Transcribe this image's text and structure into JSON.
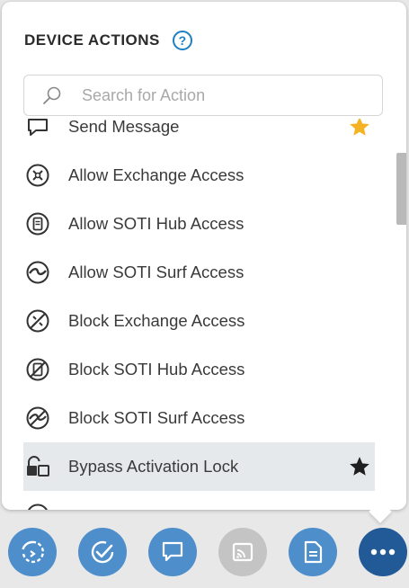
{
  "panel": {
    "title": "DEVICE ACTIONS",
    "help_glyph": "?"
  },
  "search": {
    "placeholder": "Search for Action",
    "value": ""
  },
  "actions": [
    {
      "label": "Send Message",
      "icon": "chat-bubble-icon",
      "favorite": true
    },
    {
      "label": "Allow Exchange Access",
      "icon": "exchange-icon",
      "favorite": false
    },
    {
      "label": "Allow SOTI Hub Access",
      "icon": "hub-icon",
      "favorite": false
    },
    {
      "label": "Allow SOTI Surf Access",
      "icon": "surf-icon",
      "favorite": false
    },
    {
      "label": "Block Exchange Access",
      "icon": "exchange-blocked-icon",
      "favorite": false
    },
    {
      "label": "Block SOTI Hub Access",
      "icon": "hub-blocked-icon",
      "favorite": false
    },
    {
      "label": "Block SOTI Surf Access",
      "icon": "surf-blocked-icon",
      "favorite": false
    },
    {
      "label": "Bypass Activation Lock",
      "icon": "unlock-icon",
      "favorite": true,
      "highlighted": true
    },
    {
      "label": "",
      "icon": "partial-icon",
      "favorite": false
    }
  ],
  "colors": {
    "accent": "#1e7fc1",
    "dock_button": "#4d8ecb",
    "dock_button_active": "#215a97",
    "dock_button_disabled": "#c4c4c4",
    "star_gold": "#f5b324",
    "highlight_row": "#e6e9ec"
  },
  "dock": [
    {
      "name": "refresh-action-icon",
      "state": "normal"
    },
    {
      "name": "check-circle-icon",
      "state": "normal"
    },
    {
      "name": "message-icon",
      "state": "normal"
    },
    {
      "name": "remote-cast-icon",
      "state": "disabled"
    },
    {
      "name": "document-icon",
      "state": "normal"
    },
    {
      "name": "more-actions-icon",
      "state": "active"
    }
  ]
}
